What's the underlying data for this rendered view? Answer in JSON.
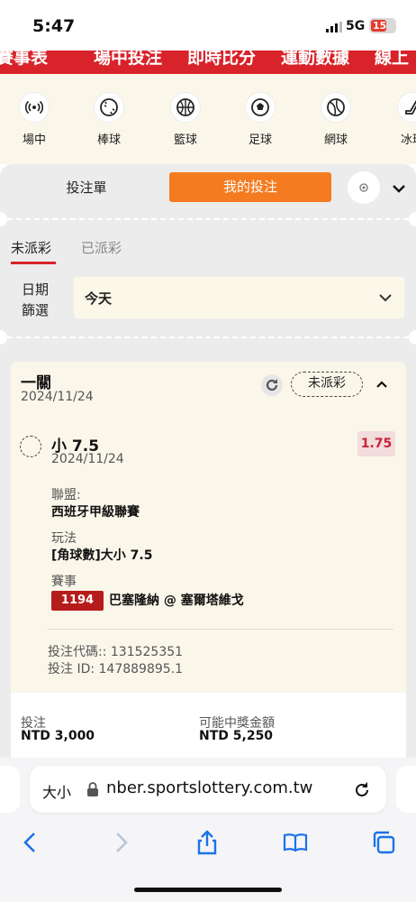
{
  "status_bar": {
    "time": "5:47",
    "network": "5G",
    "battery": "15"
  },
  "top_nav": {
    "items": [
      "賽事表",
      "場中投注",
      "即時比分",
      "運動數據",
      "線上"
    ]
  },
  "sports": [
    {
      "label": "場中",
      "icon": "live-broadcast-icon"
    },
    {
      "label": "棒球",
      "icon": "baseball-icon"
    },
    {
      "label": "籃球",
      "icon": "basketball-icon"
    },
    {
      "label": "足球",
      "icon": "soccer-ball-icon"
    },
    {
      "label": "網球",
      "icon": "tennis-ball-icon"
    },
    {
      "label": "冰球",
      "icon": "hockey-stick-icon"
    }
  ],
  "tabs": {
    "betslip": "投注單",
    "my_bets": "我的投注"
  },
  "subtabs": {
    "unsettled": "未派彩",
    "settled": "已派彩"
  },
  "date_filter": {
    "label": "日期篩選",
    "value": "今天"
  },
  "bet": {
    "type": "一關",
    "date": "2024/11/24",
    "status": "未派彩",
    "selection": "小 7.5",
    "selection_date": "2024/11/24",
    "odds": "1.75",
    "league_label": "聯盟:",
    "league": "西班牙甲級聯賽",
    "market_label": "玩法",
    "market": "[角球數]大小 7.5",
    "event_label": "賽事",
    "event_code": "1194",
    "event": "巴塞隆納 @ 塞爾塔維戈",
    "bet_code": "投注代碼:: 131525351",
    "bet_id": "投注 ID: 147889895.1",
    "stake_label": "投注",
    "stake": "NTD 3,000",
    "payout_label": "可能中獎金額",
    "payout": "NTD 5,250"
  },
  "browser": {
    "text_size": "大小",
    "url": "nber.sportslottery.com.tw"
  },
  "colors": {
    "brand_red": "#d8232a",
    "accent_orange": "#f47b20",
    "odds_red": "#c7243a",
    "cream": "#faf7ea"
  }
}
